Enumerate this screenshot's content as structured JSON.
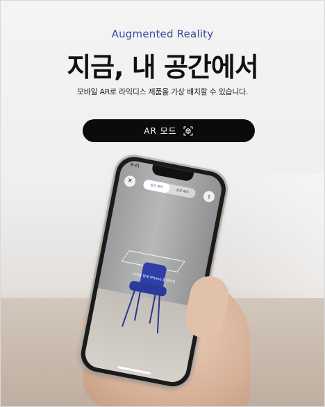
{
  "hero": {
    "eyebrow": "Augmented Reality",
    "headline": "지금, 내 공간에서",
    "subtitle": "모바일 AR로 라익디스 제품을 가상 배치할 수 있습니다."
  },
  "ar_button": {
    "label": "AR 모드",
    "icon": "ar-cube-icon"
  },
  "phone_screen": {
    "status_time": "9:41",
    "close_icon": "close-icon",
    "share_icon": "share-icon",
    "segment_tabs": [
      {
        "label": "공간 위치",
        "active": true
      },
      {
        "label": "공간 배치",
        "active": false
      }
    ],
    "ar_hint": "나이에 맞게 iPhone 움직이기"
  },
  "colors": {
    "eyebrow": "#3a4a9c",
    "button_bg": "#0b0b0b",
    "chair": "#2a3a9c"
  }
}
